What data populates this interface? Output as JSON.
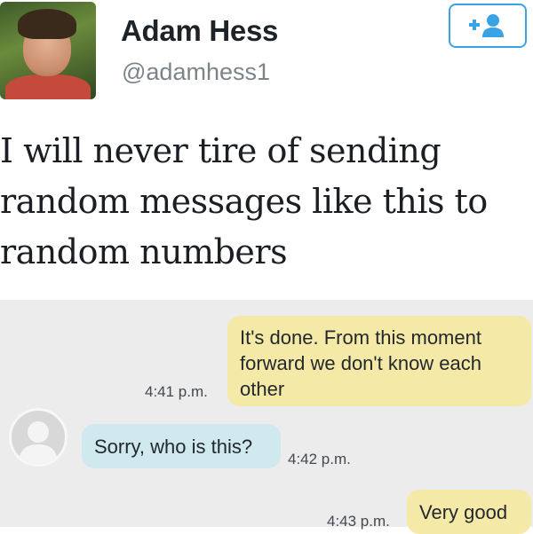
{
  "tweet": {
    "display_name": "Adam Hess",
    "handle": "@adamhess1",
    "text_lines": [
      "I will never tire of sending",
      "random messages like this to",
      "random numbers"
    ],
    "follow_icon": "add-user-icon",
    "accent_color": "#3aa3e3"
  },
  "messages": [
    {
      "direction": "outgoing",
      "lines": [
        "It's done. From this moment",
        "forward we don't know each",
        "other"
      ],
      "time": "4:41 p.m."
    },
    {
      "direction": "incoming",
      "lines": [
        "Sorry, who is this?"
      ],
      "time": "4:42 p.m."
    },
    {
      "direction": "outgoing",
      "lines": [
        "Very good"
      ],
      "time": "4:43 p.m."
    }
  ],
  "colors": {
    "outgoing_bubble": "#f5e9a8",
    "incoming_bubble": "#cfe9ef",
    "sms_background": "#ececed"
  }
}
